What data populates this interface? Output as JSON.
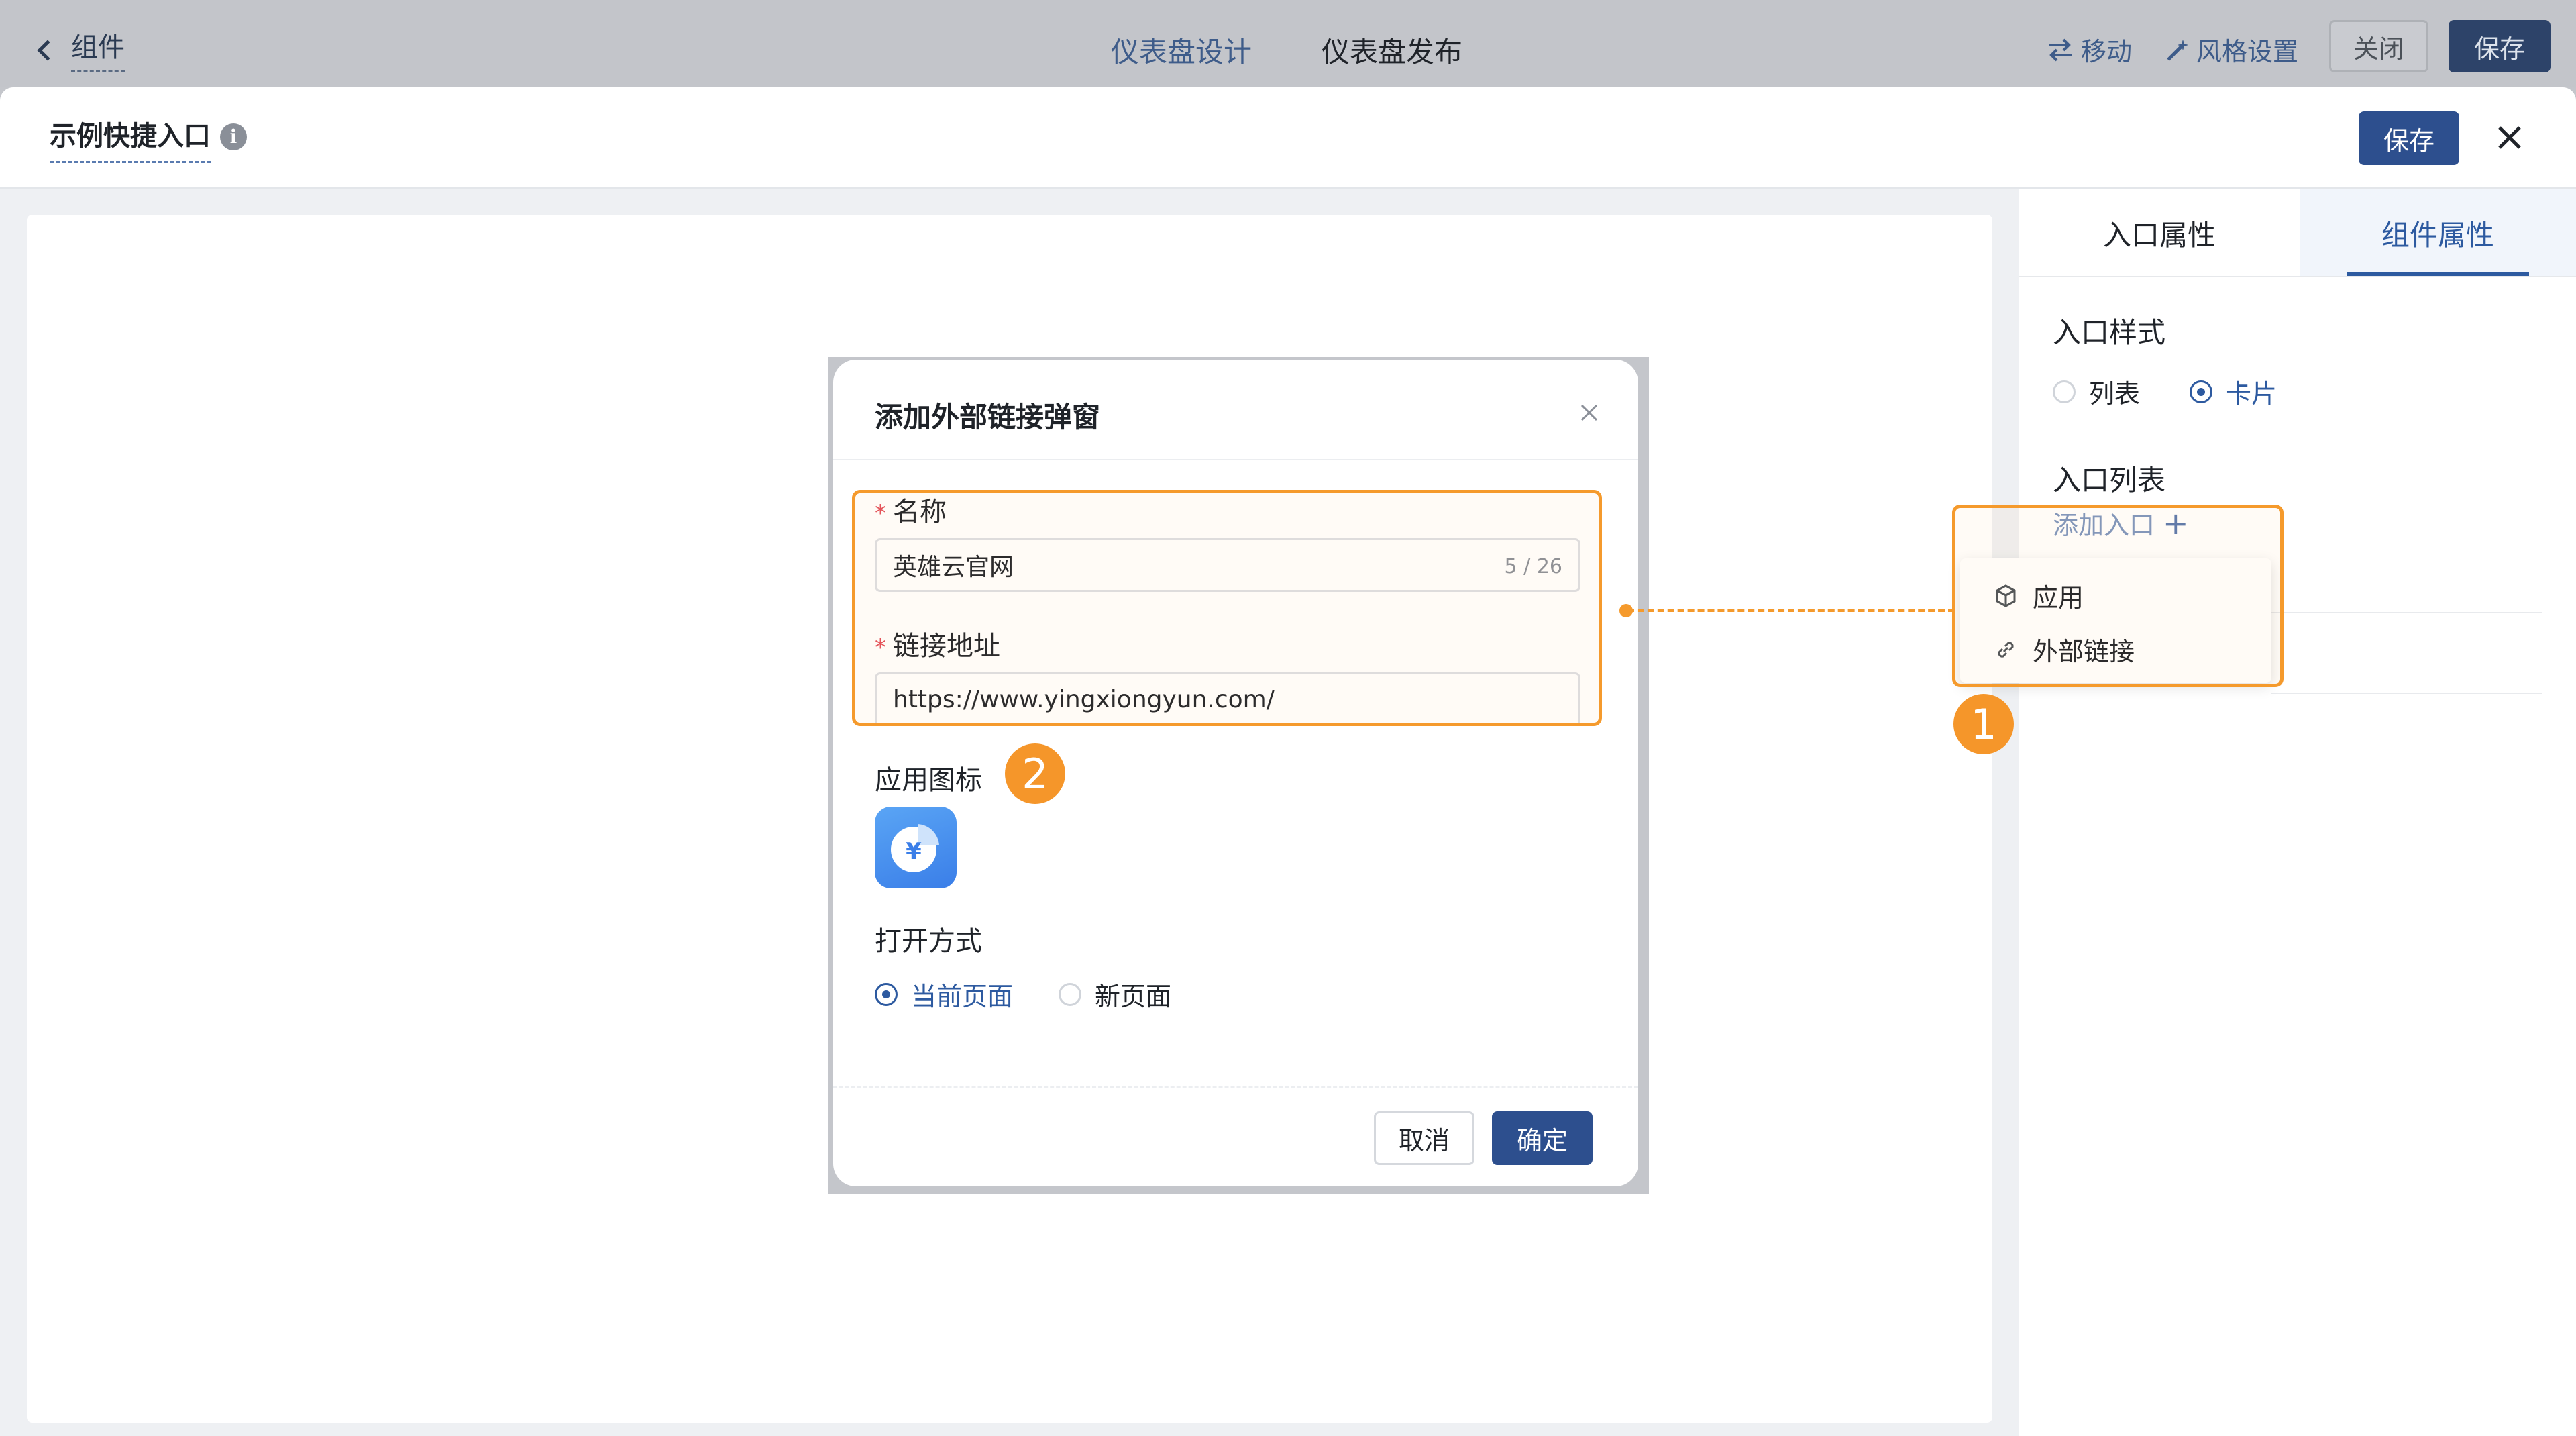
{
  "topbar": {
    "back_label": "组件",
    "nav": [
      "仪表盘设计",
      "仪表盘发布"
    ],
    "move_label": "移动",
    "style_label": "风格设置",
    "close_label": "关闭",
    "save_label": "保存"
  },
  "panel": {
    "title": "示例快捷入口",
    "info_symbol": "i",
    "save_label": "保存"
  },
  "props": {
    "tabs": [
      "入口属性",
      "组件属性"
    ],
    "active_tab": "组件属性",
    "entry_style_title": "入口样式",
    "style_options": [
      "列表",
      "卡片"
    ],
    "selected_style": "卡片",
    "entry_list_title": "入口列表",
    "add_entry_label": "添加入口",
    "add_symbol": "+",
    "dropdown": [
      {
        "label": "应用",
        "icon": "cube-icon"
      },
      {
        "label": "外部链接",
        "icon": "link-icon"
      }
    ]
  },
  "modal": {
    "title": "添加外部链接弹窗",
    "required_mark": "*",
    "name_label": "名称",
    "name_value": "英雄云官网",
    "name_count": "5 / 26",
    "url_label": "链接地址",
    "url_value": "https://www.yingxiongyun.com/",
    "icon_label": "应用图标",
    "icon_symbol": "¥",
    "open_label": "打开方式",
    "open_options": [
      "当前页面",
      "新页面"
    ],
    "selected_open": "当前页面",
    "cancel_label": "取消",
    "ok_label": "确定"
  },
  "annotations": {
    "badge_1": "1",
    "badge_2": "2",
    "color": "#f59a2c"
  },
  "colors": {
    "primary": "#2d4f8e",
    "accent_text": "#2d5aa0",
    "overlay": "#c4c6cb"
  }
}
